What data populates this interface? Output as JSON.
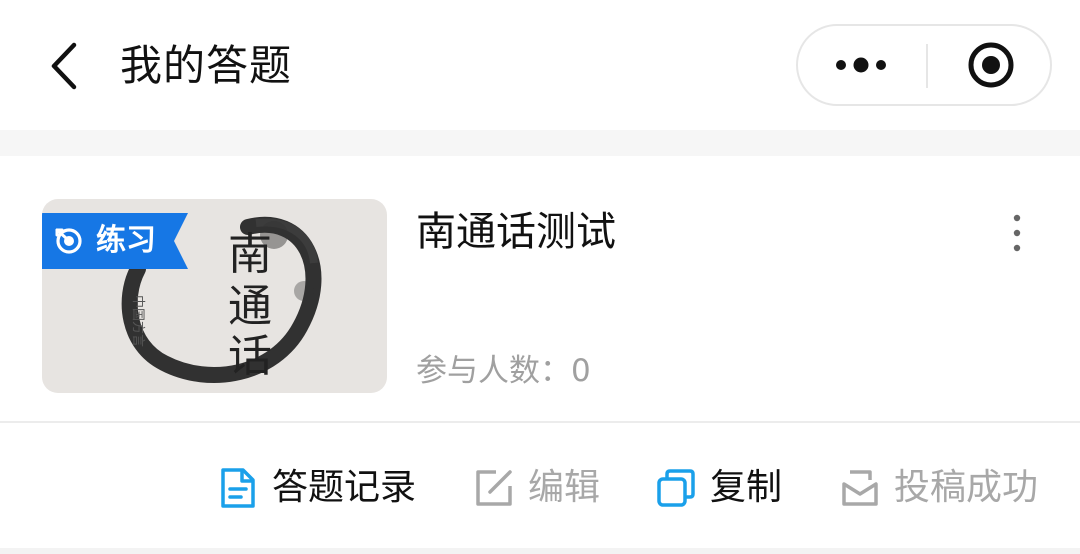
{
  "header": {
    "title": "我的答题"
  },
  "card": {
    "tag_label": "练习",
    "thumbnail_text": "南通话",
    "thumbnail_subtext": "中国方言",
    "title": "南通话测试",
    "participants": "参与人数：0"
  },
  "actions": {
    "record": "答题记录",
    "edit": "编辑",
    "copy": "复制",
    "submit": "投稿成功"
  },
  "colors": {
    "tag_blue": "#1677e5",
    "icon_blue": "#1aa0ea",
    "muted": "#a8a8a8",
    "text": "#111111"
  },
  "icons": [
    "back-arrow-icon",
    "more-dots-icon",
    "close-circle-icon",
    "target-icon",
    "kebab-icon",
    "document-icon",
    "edit-icon",
    "copy-icon",
    "submit-box-icon"
  ]
}
